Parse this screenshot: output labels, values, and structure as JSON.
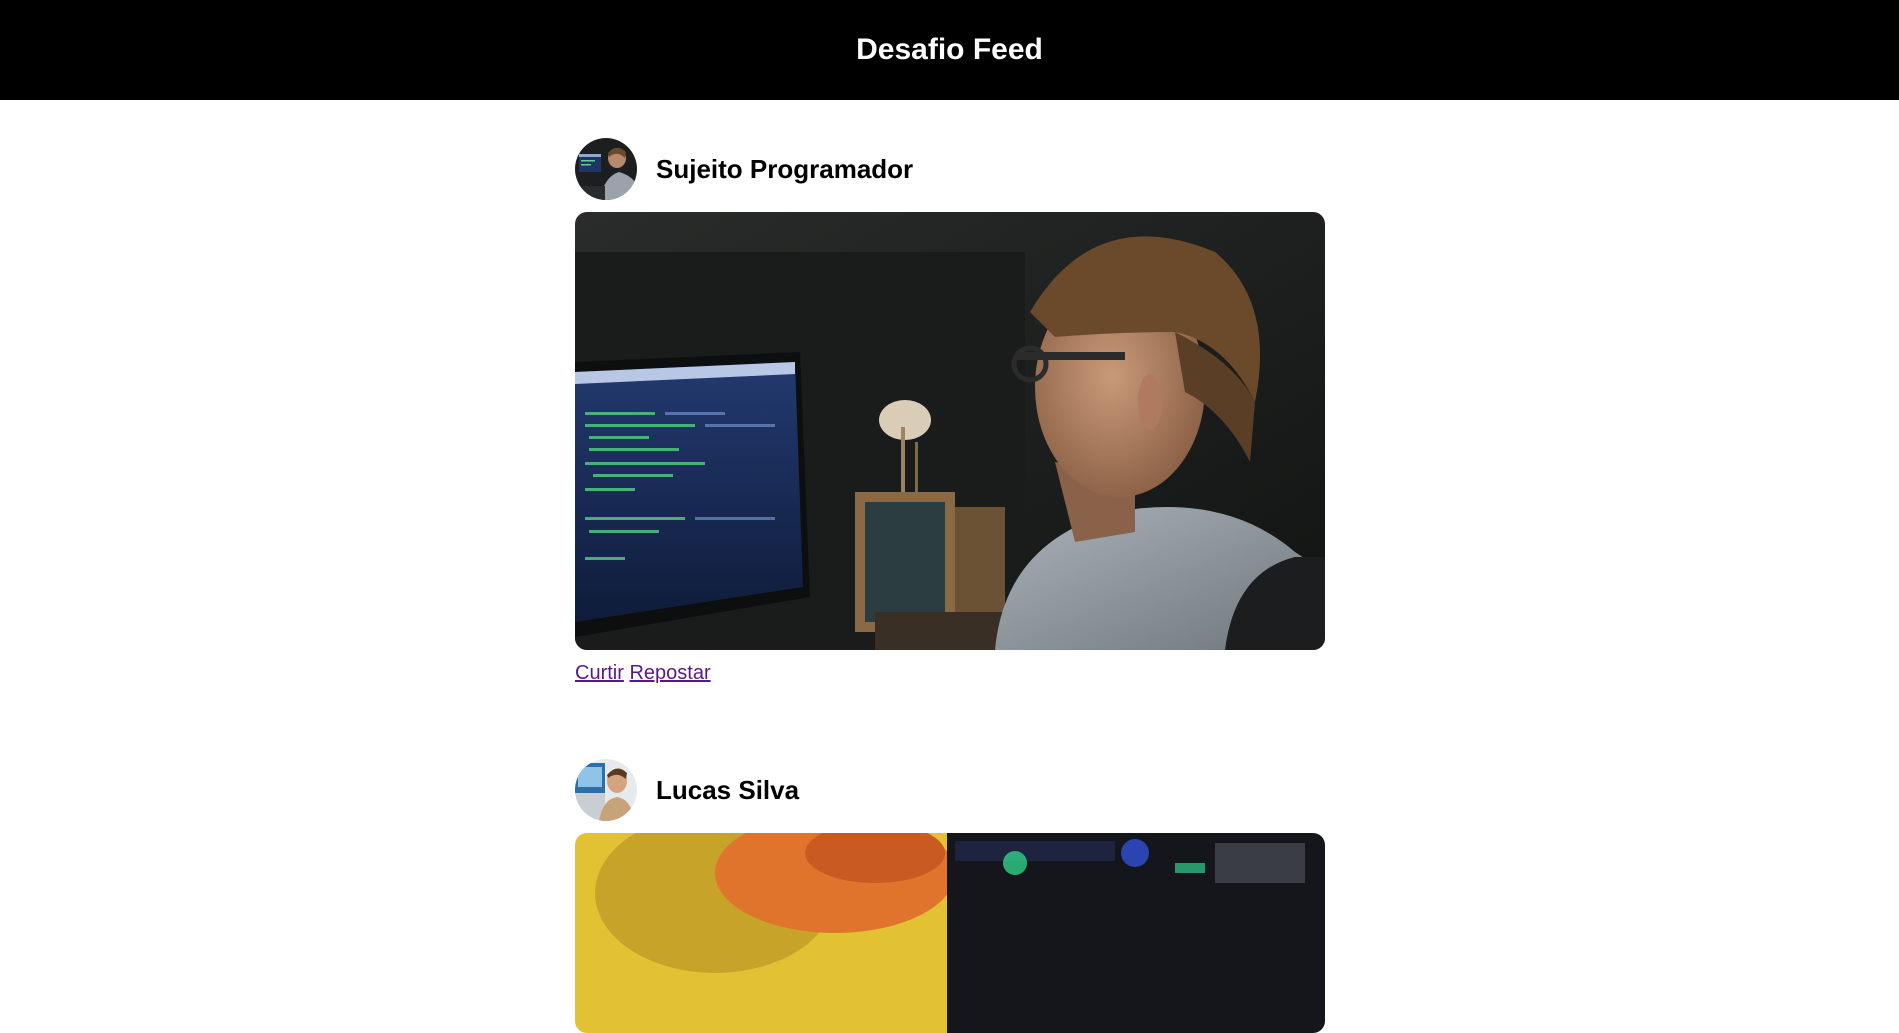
{
  "header": {
    "title": "Desafio Feed"
  },
  "posts": [
    {
      "author": "Sujeito Programador",
      "actions": {
        "like_label": "Curtir",
        "repost_label": "Repostar"
      },
      "image_subject": "programmer-at-monitor-photo"
    },
    {
      "author": "Lucas Silva",
      "image_subject": "food-and-pc-collage-photo"
    }
  ],
  "colors": {
    "header_bg": "#000000",
    "header_text": "#ffffff",
    "link_visited": "#551a8b"
  }
}
